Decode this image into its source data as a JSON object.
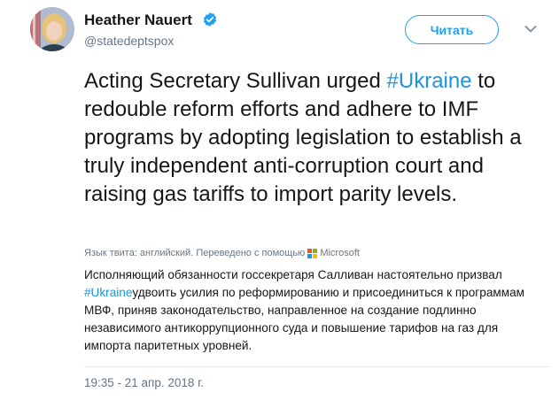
{
  "author": {
    "name": "Heather Nauert",
    "handle": "@statedeptspox",
    "verified": true
  },
  "follow_button": {
    "label": "Читать"
  },
  "tweet": {
    "text_before": "Acting Secretary Sullivan urged ",
    "hashtag": "#Ukraine",
    "text_after": " to redouble reform efforts and adhere to IMF programs by adopting legislation to establish a truly independent anti-corruption court and raising gas tariffs to import parity levels."
  },
  "translation": {
    "meta_label": "Язык твита: английский. Переведено с помощью",
    "provider": "Microsoft",
    "text_before": "Исполняющий обязанности госсекретаря Салливан настоятельно призвал ",
    "hashtag": "#Ukraine",
    "text_after": "удвоить усилия по реформированию и присоединиться к программам МВФ, приняв законодательство, направленное на создание подлинно независимого антикоррупционного суда и повышение тарифов на газ для импорта паритетных уровней."
  },
  "timestamp": "19:35 - 21 апр. 2018 г.",
  "colors": {
    "accent": "#1da1f2",
    "hashtag": "#1b95e0",
    "secondary_text": "#657786",
    "verified_badge": "#1da1f2"
  },
  "icons": {
    "verified": "verified-badge-icon",
    "caret": "chevron-down-icon",
    "translator_logo": "microsoft-logo-icon"
  }
}
